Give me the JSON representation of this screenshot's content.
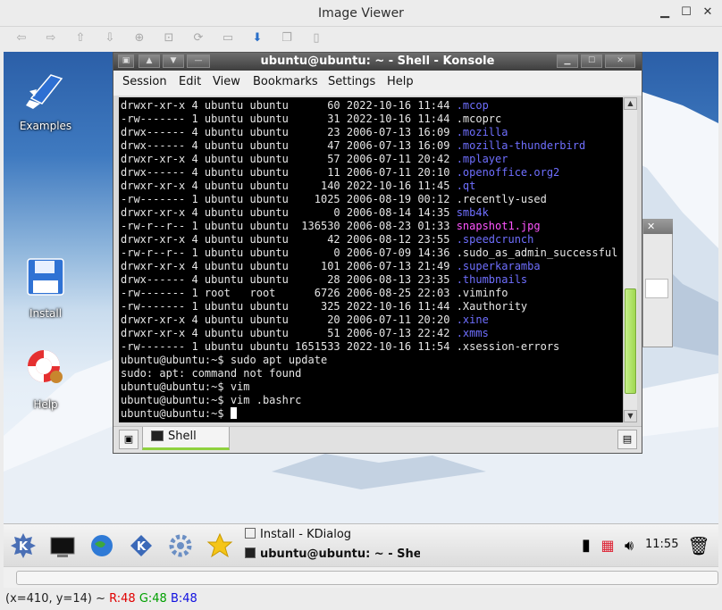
{
  "viewer": {
    "title": "Image Viewer",
    "status_coords": "(x=410, y=14) ~",
    "status_r": "R:48",
    "status_g": "G:48",
    "status_b": "B:48"
  },
  "desktop": {
    "icons": [
      {
        "label": "Examples",
        "icon": "book-arrow-icon"
      },
      {
        "label": "Install",
        "icon": "floppy-disk-icon"
      },
      {
        "label": "Help",
        "icon": "lifebuoy-icon"
      }
    ]
  },
  "konsole": {
    "title": "ubuntu@ubuntu: ~ - Shell - Konsole",
    "menus": [
      "Session",
      "Edit",
      "View",
      "Bookmarks",
      "Settings",
      "Help"
    ],
    "tab_label": "Shell",
    "listing": [
      {
        "perm": "drwxr-xr-x",
        "links": "4",
        "user": "ubuntu",
        "group": "ubuntu",
        "size": "60",
        "date": "2022-10-16",
        "time": "11:44",
        "name": ".mcop",
        "kind": "d"
      },
      {
        "perm": "-rw-------",
        "links": "1",
        "user": "ubuntu",
        "group": "ubuntu",
        "size": "31",
        "date": "2022-10-16",
        "time": "11:44",
        "name": ".mcoprc",
        "kind": "f"
      },
      {
        "perm": "drwx------",
        "links": "4",
        "user": "ubuntu",
        "group": "ubuntu",
        "size": "23",
        "date": "2006-07-13",
        "time": "16:09",
        "name": ".mozilla",
        "kind": "d"
      },
      {
        "perm": "drwx------",
        "links": "4",
        "user": "ubuntu",
        "group": "ubuntu",
        "size": "47",
        "date": "2006-07-13",
        "time": "16:09",
        "name": ".mozilla-thunderbird",
        "kind": "d"
      },
      {
        "perm": "drwxr-xr-x",
        "links": "4",
        "user": "ubuntu",
        "group": "ubuntu",
        "size": "57",
        "date": "2006-07-11",
        "time": "20:42",
        "name": ".mplayer",
        "kind": "d"
      },
      {
        "perm": "drwx------",
        "links": "4",
        "user": "ubuntu",
        "group": "ubuntu",
        "size": "11",
        "date": "2006-07-11",
        "time": "20:10",
        "name": ".openoffice.org2",
        "kind": "d"
      },
      {
        "perm": "drwxr-xr-x",
        "links": "4",
        "user": "ubuntu",
        "group": "ubuntu",
        "size": "140",
        "date": "2022-10-16",
        "time": "11:45",
        "name": ".qt",
        "kind": "d"
      },
      {
        "perm": "-rw-------",
        "links": "1",
        "user": "ubuntu",
        "group": "ubuntu",
        "size": "1025",
        "date": "2006-08-19",
        "time": "00:12",
        "name": ".recently-used",
        "kind": "f"
      },
      {
        "perm": "drwxr-xr-x",
        "links": "4",
        "user": "ubuntu",
        "group": "ubuntu",
        "size": "0",
        "date": "2006-08-14",
        "time": "14:35",
        "name": "smb4k",
        "kind": "d"
      },
      {
        "perm": "-rw-r--r--",
        "links": "1",
        "user": "ubuntu",
        "group": "ubuntu",
        "size": "136530",
        "date": "2006-08-23",
        "time": "01:33",
        "name": "snapshot1.jpg",
        "kind": "img"
      },
      {
        "perm": "drwxr-xr-x",
        "links": "4",
        "user": "ubuntu",
        "group": "ubuntu",
        "size": "42",
        "date": "2006-08-12",
        "time": "23:55",
        "name": ".speedcrunch",
        "kind": "d"
      },
      {
        "perm": "-rw-r--r--",
        "links": "1",
        "user": "ubuntu",
        "group": "ubuntu",
        "size": "0",
        "date": "2006-07-09",
        "time": "14:36",
        "name": ".sudo_as_admin_successful",
        "kind": "f"
      },
      {
        "perm": "drwxr-xr-x",
        "links": "4",
        "user": "ubuntu",
        "group": "ubuntu",
        "size": "101",
        "date": "2006-07-13",
        "time": "21:49",
        "name": ".superkaramba",
        "kind": "d"
      },
      {
        "perm": "drwx------",
        "links": "4",
        "user": "ubuntu",
        "group": "ubuntu",
        "size": "28",
        "date": "2006-08-13",
        "time": "23:35",
        "name": ".thumbnails",
        "kind": "d"
      },
      {
        "perm": "-rw-------",
        "links": "1",
        "user": "root",
        "group": "root",
        "size": "6726",
        "date": "2006-08-25",
        "time": "22:03",
        "name": ".viminfo",
        "kind": "f"
      },
      {
        "perm": "-rw-------",
        "links": "1",
        "user": "ubuntu",
        "group": "ubuntu",
        "size": "325",
        "date": "2022-10-16",
        "time": "11:44",
        "name": ".Xauthority",
        "kind": "f"
      },
      {
        "perm": "drwxr-xr-x",
        "links": "4",
        "user": "ubuntu",
        "group": "ubuntu",
        "size": "20",
        "date": "2006-07-11",
        "time": "20:20",
        "name": ".xine",
        "kind": "d"
      },
      {
        "perm": "drwxr-xr-x",
        "links": "4",
        "user": "ubuntu",
        "group": "ubuntu",
        "size": "51",
        "date": "2006-07-13",
        "time": "22:42",
        "name": ".xmms",
        "kind": "d"
      },
      {
        "perm": "-rw-------",
        "links": "1",
        "user": "ubuntu",
        "group": "ubuntu",
        "size": "1651533",
        "date": "2022-10-16",
        "time": "11:54",
        "name": ".xsession-errors",
        "kind": "f"
      }
    ],
    "tail": [
      "ubuntu@ubuntu:~$ sudo apt update",
      "sudo: apt: command not found",
      "ubuntu@ubuntu:~$ vim",
      "ubuntu@ubuntu:~$ vim .bashrc",
      "ubuntu@ubuntu:~$ "
    ]
  },
  "taskbar": {
    "tasks": [
      "Install - KDialog",
      "ubuntu@ubuntu: ~ - Shel"
    ],
    "clock": "11:55"
  },
  "colors": {
    "terminal_bg": "#000000",
    "dir": "#6f6fff",
    "image": "#ff55ff",
    "scroll_thumb": "#9fd84f"
  }
}
